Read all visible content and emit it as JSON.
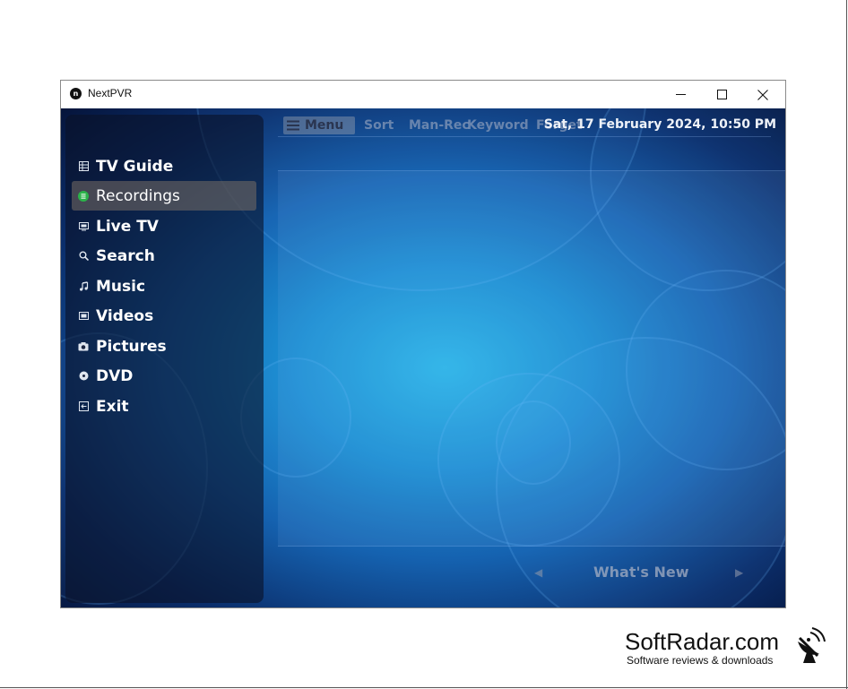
{
  "window": {
    "title": "NextPVR",
    "app_icon": "n-logo",
    "controls": [
      "minimize-icon",
      "maximize-icon",
      "close-icon"
    ]
  },
  "topbar": {
    "menu_label": "Menu",
    "links": [
      "Sort",
      "Man-Rec",
      "Keyword",
      "Forget"
    ],
    "datetime": "Sat, 17 February 2024, 10:50 PM"
  },
  "sidebar": {
    "items": [
      {
        "label": "TV Guide",
        "icon": "tv-guide-icon",
        "selected": false
      },
      {
        "label": "Recordings",
        "icon": "recordings-icon",
        "selected": true
      },
      {
        "label": "Live TV",
        "icon": "live-tv-icon",
        "selected": false
      },
      {
        "label": "Search",
        "icon": "search-icon",
        "selected": false
      },
      {
        "label": "Music",
        "icon": "music-note-icon",
        "selected": false
      },
      {
        "label": "Videos",
        "icon": "film-icon",
        "selected": false
      },
      {
        "label": "Pictures",
        "icon": "camera-icon",
        "selected": false
      },
      {
        "label": "DVD",
        "icon": "disc-icon",
        "selected": false
      },
      {
        "label": "Exit",
        "icon": "exit-icon",
        "selected": false
      }
    ]
  },
  "main": {
    "view_label": "What's New"
  },
  "watermark": {
    "brand": "SoftRadar.com",
    "tagline": "Software reviews & downloads"
  },
  "colors": {
    "accent_selected_icon": "#2bb34a",
    "background_center": "#2cb8ea",
    "background_edge": "#05143a"
  }
}
